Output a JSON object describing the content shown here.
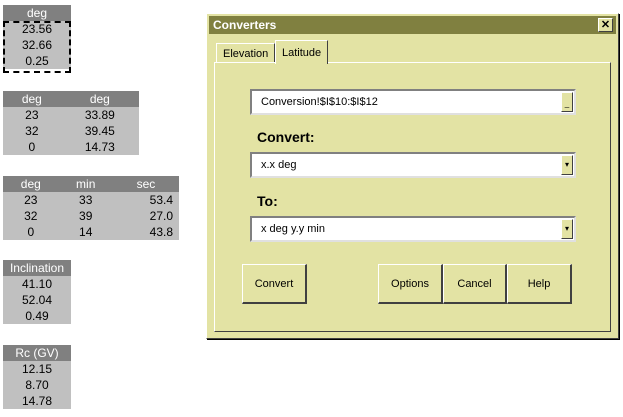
{
  "sheet": {
    "table_deg": {
      "header": "deg",
      "rows": [
        "23.56",
        "32.66",
        "0.25"
      ]
    },
    "table_deg_deg": {
      "headers": [
        "deg",
        "deg"
      ],
      "rows": [
        [
          "23",
          "33.89"
        ],
        [
          "32",
          "39.45"
        ],
        [
          "0",
          "14.73"
        ]
      ]
    },
    "table_dms": {
      "headers": [
        "deg",
        "min",
        "sec"
      ],
      "rows": [
        [
          "23",
          "33",
          "53.4"
        ],
        [
          "32",
          "39",
          "27.0"
        ],
        [
          "0",
          "14",
          "43.8"
        ]
      ]
    },
    "table_inclination": {
      "header": "Inclination",
      "rows": [
        "41.10",
        "52.04",
        "0.49"
      ]
    },
    "table_rc": {
      "header": "Rc (GV)",
      "rows": [
        "12.15",
        "8.70",
        "14.78"
      ]
    }
  },
  "dialog": {
    "title": "Converters",
    "close_glyph": "✕",
    "tabs": [
      {
        "label": "Elevation"
      },
      {
        "label": "Latitude"
      }
    ],
    "range_field": {
      "value": "Conversion!$I$10:$I$12",
      "button_glyph": "_"
    },
    "convert_label": "Convert:",
    "convert_select": {
      "value": "x.x deg",
      "arrow_glyph": "▾"
    },
    "to_label": "To:",
    "to_select": {
      "value": "x deg y.y min",
      "arrow_glyph": "▾"
    },
    "buttons": {
      "convert": "Convert",
      "options": "Options",
      "cancel": "Cancel",
      "help": "Help"
    }
  },
  "colors": {
    "dialog_bg": "#e3e3a4",
    "titlebar": "#808040",
    "header_cell": "#808080",
    "data_cell": "#c0c0c0"
  }
}
